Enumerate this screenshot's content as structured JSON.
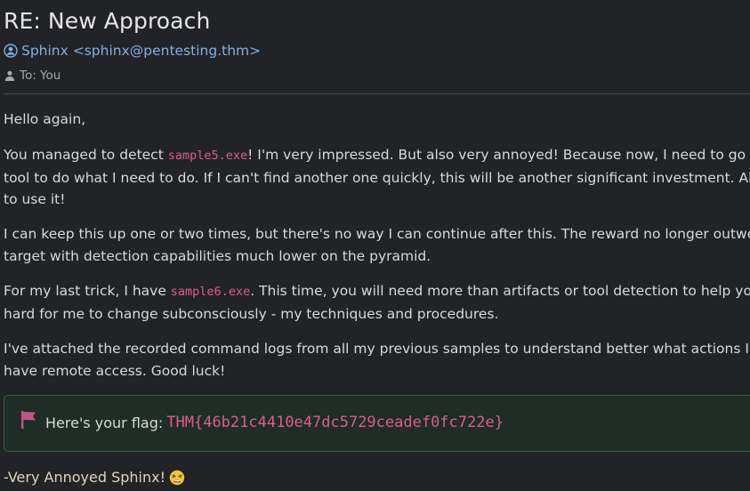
{
  "email": {
    "subject": "RE: New Approach",
    "from": "Sphinx <sphinx@pentesting.thm>",
    "to": "To: You",
    "greeting": "Hello again,",
    "p1": {
      "a": "You managed to detect ",
      "code": "sample5.exe",
      "b": "! I'm very impressed. But also very annoyed! Because now, I need to go back",
      "line2": "tool to do what I need to do. If I can't find another one quickly, this will be another significant investment. Also, I w",
      "line3": "to use it!"
    },
    "p2": {
      "line1": "I can keep this up one or two times, but there's no way I can continue after this. The reward no longer outweighs",
      "line2": "target with detection capabilities much lower on the pyramid."
    },
    "p3": {
      "a": "For my last trick, I have ",
      "code": "sample6.exe",
      "b": ". This time, you will need more than artifacts or tool detection to help you. Yo",
      "line2": "hard for me to change subconsciously - my techniques and procedures."
    },
    "p4": {
      "line1": "I've attached the recorded command logs from all my previous samples to understand better what actions I tend",
      "line2": "have remote access. Good luck!"
    },
    "flag": {
      "label": "Here's your flag:",
      "value": "THM{46b21c4410e47dc5729ceadef0fc722e}"
    },
    "signoff": "-Very Annoyed Sphinx!"
  },
  "icons": {
    "sender": "user-circle-icon",
    "recipient": "user-icon",
    "flag": "flag-icon",
    "emoji": "tired-face-emoji"
  },
  "colors": {
    "background": "#212326",
    "link": "#7fb0e8",
    "code": "#e05b8f",
    "flag_box_bg": "#1e2d25",
    "flag_box_border": "#3a5c47",
    "signoff": "#ddd5b8"
  }
}
